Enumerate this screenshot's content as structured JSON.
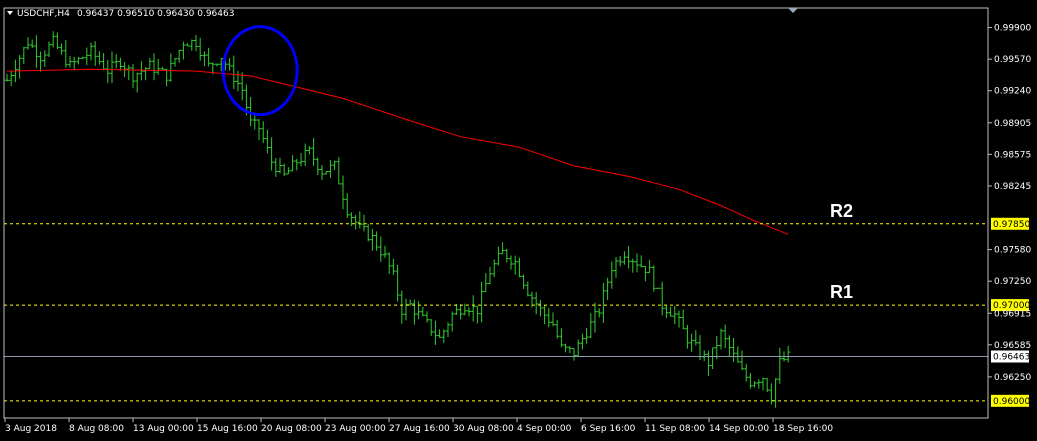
{
  "header": {
    "symbol": "USDCHF,H4",
    "ohlc": "0.96437 0.96510 0.96430 0.96463"
  },
  "colors": {
    "background": "#000000",
    "frame": "#c0c0c0",
    "bars": "#32cd32",
    "moving_average": "#ff0000",
    "level_line": "#ffff00",
    "bid_line": "#8f9bad",
    "circle": "#0000ff",
    "text": "#ffffff"
  },
  "chart_data": {
    "type": "ohlc",
    "symbol": "USDCHF",
    "timeframe": "H4",
    "ylim": [
      0.95925,
      1.0
    ],
    "y_ticks": [
      "0.99900",
      "0.99570",
      "0.99240",
      "0.98905",
      "0.98575",
      "0.98245",
      "0.97910",
      "0.97580",
      "0.97250",
      "0.96915",
      "0.96585",
      "0.96250",
      "0.95925"
    ],
    "x_ticks": [
      "3 Aug 2018",
      "8 Aug 08:00",
      "13 Aug 00:00",
      "15 Aug 16:00",
      "20 Aug 08:00",
      "23 Aug 00:00",
      "27 Aug 16:00",
      "30 Aug 08:00",
      "4 Sep 00:00",
      "6 Sep 16:00",
      "11 Sep 08:00",
      "14 Sep 00:00",
      "18 Sep 16:00"
    ],
    "close_path": [
      [
        0,
        0.9935
      ],
      [
        5,
        0.9975
      ],
      [
        8,
        0.996
      ],
      [
        11,
        0.9975
      ],
      [
        15,
        0.995
      ],
      [
        20,
        0.9965
      ],
      [
        24,
        0.9945
      ],
      [
        27,
        0.9955
      ],
      [
        30,
        0.994
      ],
      [
        34,
        0.995
      ],
      [
        38,
        0.994
      ],
      [
        42,
        0.9975
      ],
      [
        45,
        0.9975
      ],
      [
        48,
        0.995
      ],
      [
        51,
        0.996
      ],
      [
        53,
        0.9945
      ],
      [
        56,
        0.9925
      ],
      [
        58,
        0.989
      ],
      [
        60,
        0.9885
      ],
      [
        63,
        0.985
      ],
      [
        66,
        0.9835
      ],
      [
        69,
        0.985
      ],
      [
        72,
        0.986
      ],
      [
        75,
        0.984
      ],
      [
        78,
        0.9845
      ],
      [
        81,
        0.98
      ],
      [
        84,
        0.978
      ],
      [
        87,
        0.977
      ],
      [
        90,
        0.975
      ],
      [
        92,
        0.973
      ],
      [
        94,
        0.9695
      ],
      [
        96,
        0.97
      ],
      [
        98,
        0.969
      ],
      [
        100,
        0.968
      ],
      [
        103,
        0.9665
      ],
      [
        106,
        0.969
      ],
      [
        109,
        0.97
      ],
      [
        112,
        0.9695
      ],
      [
        115,
        0.9735
      ],
      [
        118,
        0.9755
      ],
      [
        121,
        0.9745
      ],
      [
        124,
        0.9715
      ],
      [
        127,
        0.9695
      ],
      [
        130,
        0.968
      ],
      [
        132,
        0.9655
      ],
      [
        135,
        0.965
      ],
      [
        137,
        0.9665
      ],
      [
        139,
        0.968
      ],
      [
        141,
        0.9695
      ],
      [
        144,
        0.974
      ],
      [
        147,
        0.9755
      ],
      [
        150,
        0.9745
      ],
      [
        153,
        0.9735
      ],
      [
        156,
        0.97
      ],
      [
        159,
        0.969
      ],
      [
        162,
        0.9665
      ],
      [
        165,
        0.965
      ],
      [
        167,
        0.964
      ],
      [
        170,
        0.967
      ],
      [
        172,
        0.9655
      ],
      [
        175,
        0.963
      ],
      [
        177,
        0.962
      ],
      [
        180,
        0.9625
      ],
      [
        182,
        0.9605
      ],
      [
        184,
        0.964
      ],
      [
        186,
        0.9646
      ]
    ],
    "bar_count": 187,
    "moving_average": [
      [
        0,
        0.99445
      ],
      [
        20,
        0.99465
      ],
      [
        45,
        0.99445
      ],
      [
        58,
        0.99395
      ],
      [
        68,
        0.9929
      ],
      [
        80,
        0.9916
      ],
      [
        95,
        0.9894
      ],
      [
        108,
        0.9876
      ],
      [
        122,
        0.9865
      ],
      [
        135,
        0.98455
      ],
      [
        148,
        0.98345
      ],
      [
        160,
        0.9821
      ],
      [
        170,
        0.9804
      ],
      [
        178,
        0.9788
      ],
      [
        186,
        0.9774
      ]
    ],
    "levels": [
      {
        "label": "R2",
        "value": 0.9785,
        "price_text": "0.97850"
      },
      {
        "label": "R1",
        "value": 0.97,
        "price_text": "0.97000"
      },
      {
        "label": "",
        "value": 0.96,
        "price_text": "0.96000"
      }
    ],
    "bid": {
      "value": 0.96463,
      "price_text": "0.96463"
    },
    "highlight_circle": {
      "bar_center": 56,
      "price_center": 0.9945
    }
  }
}
